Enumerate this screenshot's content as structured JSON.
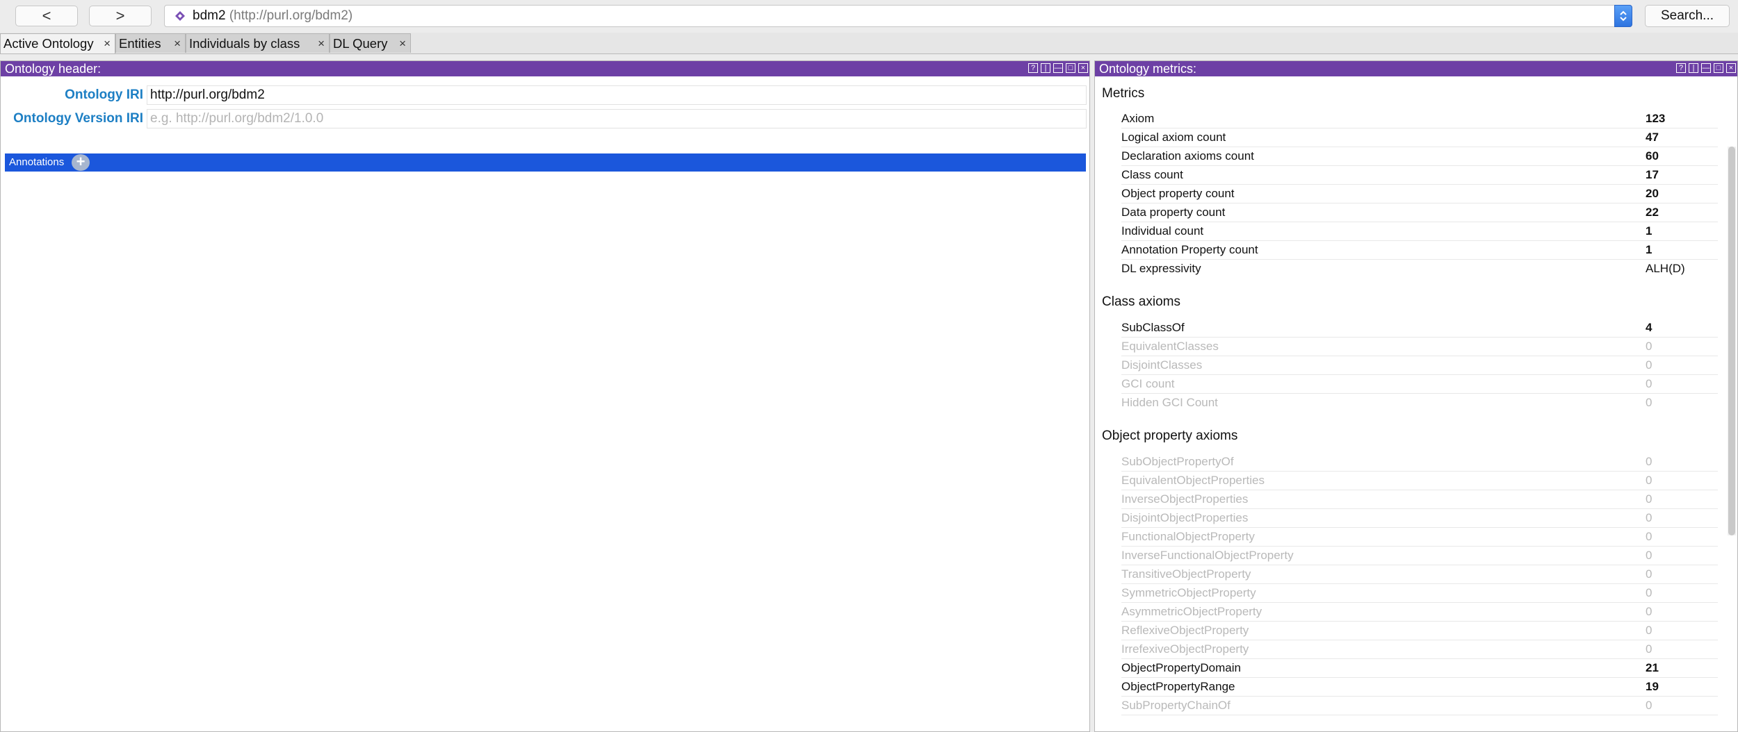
{
  "toolbar": {
    "back_label": "<",
    "forward_label": ">",
    "address_name": "bdm2",
    "address_iri": "(http://purl.org/bdm2)",
    "search_label": "Search..."
  },
  "tabs": [
    {
      "label": "Active Ontology",
      "close": "×"
    },
    {
      "label": "Entities",
      "close": "×"
    },
    {
      "label": "Individuals by class",
      "close": "×"
    },
    {
      "label": "DL Query",
      "close": "×"
    }
  ],
  "left_panel": {
    "title": "Ontology header:",
    "controls": [
      "?",
      "|",
      "—",
      "□",
      "×"
    ],
    "ontology_iri_label": "Ontology IRI",
    "ontology_iri_value": "http://purl.org/bdm2",
    "version_iri_label": "Ontology Version IRI",
    "version_iri_placeholder": "e.g. http://purl.org/bdm2/1.0.0",
    "annotations_label": "Annotations",
    "annotations_add": "+"
  },
  "right_panel": {
    "title": "Ontology metrics:",
    "controls": [
      "?",
      "|",
      "—",
      "□",
      "×"
    ],
    "sections": [
      {
        "title": "Metrics",
        "rows": [
          {
            "name": "Axiom",
            "value": "123"
          },
          {
            "name": "Logical axiom count",
            "value": "47"
          },
          {
            "name": "Declaration axioms count",
            "value": "60"
          },
          {
            "name": "Class count",
            "value": "17"
          },
          {
            "name": "Object property count",
            "value": "20"
          },
          {
            "name": "Data property count",
            "value": "22"
          },
          {
            "name": "Individual count",
            "value": "1"
          },
          {
            "name": "Annotation Property count",
            "value": "1"
          },
          {
            "name": "DL expressivity",
            "value": "ALH(D)"
          }
        ]
      },
      {
        "title": "Class axioms",
        "rows": [
          {
            "name": "SubClassOf",
            "value": "4"
          },
          {
            "name": "EquivalentClasses",
            "value": "0"
          },
          {
            "name": "DisjointClasses",
            "value": "0"
          },
          {
            "name": "GCI count",
            "value": "0"
          },
          {
            "name": "Hidden GCI Count",
            "value": "0"
          }
        ]
      },
      {
        "title": "Object property axioms",
        "rows": [
          {
            "name": "SubObjectPropertyOf",
            "value": "0"
          },
          {
            "name": "EquivalentObjectProperties",
            "value": "0"
          },
          {
            "name": "InverseObjectProperties",
            "value": "0"
          },
          {
            "name": "DisjointObjectProperties",
            "value": "0"
          },
          {
            "name": "FunctionalObjectProperty",
            "value": "0"
          },
          {
            "name": "InverseFunctionalObjectProperty",
            "value": "0"
          },
          {
            "name": "TransitiveObjectProperty",
            "value": "0"
          },
          {
            "name": "SymmetricObjectProperty",
            "value": "0"
          },
          {
            "name": "AsymmetricObjectProperty",
            "value": "0"
          },
          {
            "name": "ReflexiveObjectProperty",
            "value": "0"
          },
          {
            "name": "IrrefexiveObjectProperty",
            "value": "0"
          },
          {
            "name": "ObjectPropertyDomain",
            "value": "21"
          },
          {
            "name": "ObjectPropertyRange",
            "value": "19"
          },
          {
            "name": "SubPropertyChainOf",
            "value": "0"
          }
        ]
      }
    ]
  },
  "colors": {
    "panel_title_bg": "#6d40a5",
    "annotations_bar": "#1b57dc",
    "label_blue": "#1d7fc4"
  }
}
